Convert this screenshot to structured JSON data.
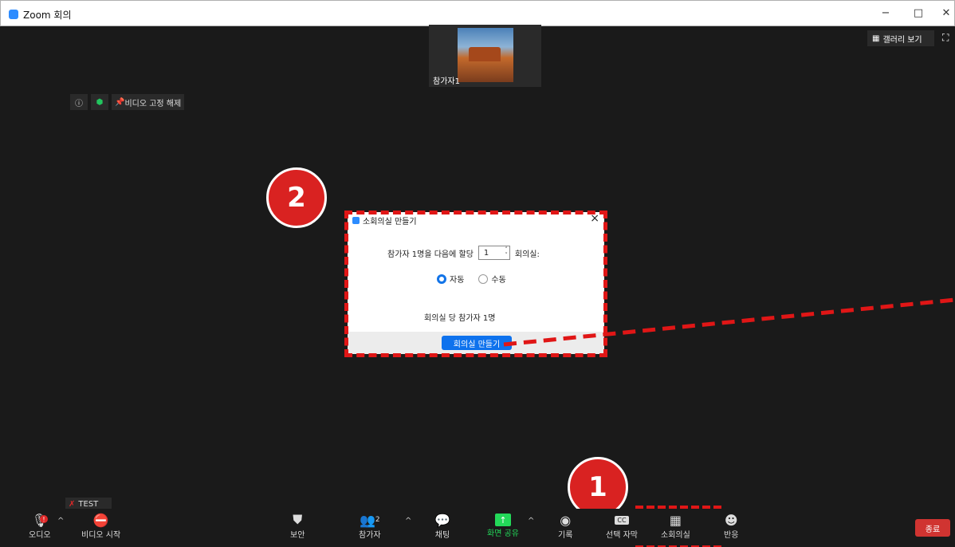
{
  "window": {
    "title": "Zoom 회의",
    "minimize": "−",
    "maximize": "□",
    "close": "✕"
  },
  "video": {
    "participant_label": "참가자1",
    "gallery_label": "갤러리 보기",
    "unpin_label": "비디오 고정 해제"
  },
  "steps": {
    "one": "1",
    "two": "2"
  },
  "dialog": {
    "title": "소회의실 만들기",
    "assign_prefix": "참가자 1명을 다음에 할당",
    "room_count": "1",
    "assign_suffix": "회의실:",
    "auto_label": "자동",
    "manual_label": "수동",
    "per_room": "회의실 당 참가자 1명",
    "create_button": "회의실 만들기"
  },
  "toolbar": {
    "test_label": "TEST",
    "audio": "오디오",
    "video": "비디오 시작",
    "security": "보안",
    "participants": "참가자",
    "participant_count": "2",
    "chat": "채팅",
    "share": "화면 공유",
    "record": "기록",
    "captions": "선택 자막",
    "breakout": "소회의실",
    "reactions": "반응",
    "end": "종료",
    "caption_icon_text": "CC",
    "share_color": "#23d959"
  }
}
